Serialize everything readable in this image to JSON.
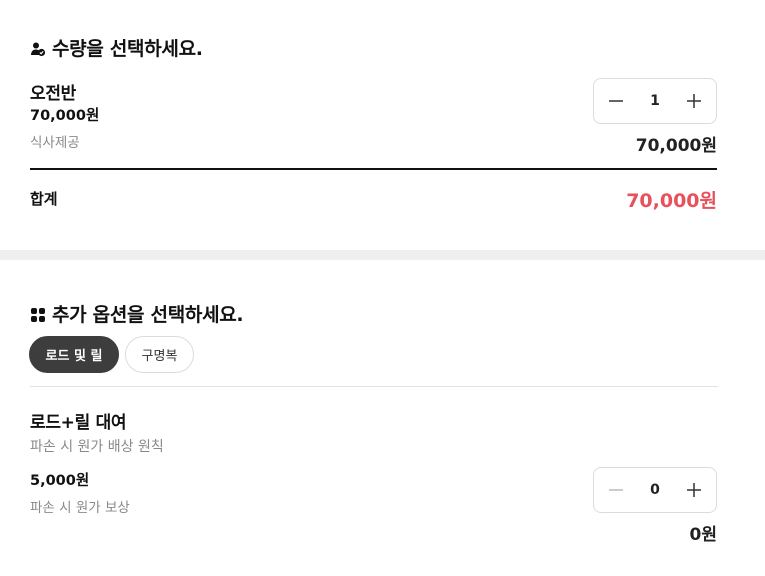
{
  "quantity_section": {
    "title": "수량을 선택하세요.",
    "item": {
      "name": "오전반",
      "price": "70,000원",
      "note": "식사제공",
      "quantity": "1",
      "line_total": "70,000원"
    },
    "summary": {
      "label": "합계",
      "total": "70,000원"
    }
  },
  "options_section": {
    "title": "추가 옵션을 선택하세요.",
    "tabs": [
      {
        "label": "로드 및 릴",
        "active": true
      },
      {
        "label": "구명복",
        "active": false
      }
    ],
    "option": {
      "name": "로드+릴 대여",
      "subtitle": "파손 시 원가 배상 원칙",
      "price": "5,000원",
      "note": "파손 시 원가 보상",
      "quantity": "0",
      "line_total": "0원"
    }
  },
  "colors": {
    "accent_total": "#e8505b",
    "active_chip": "#3d3d3d",
    "section_divider": "#efefef"
  },
  "icons": {
    "quantity_title_icon": "people-check-icon",
    "options_title_icon": "grid-plus-icon",
    "minus": "minus-icon",
    "plus": "plus-icon"
  }
}
